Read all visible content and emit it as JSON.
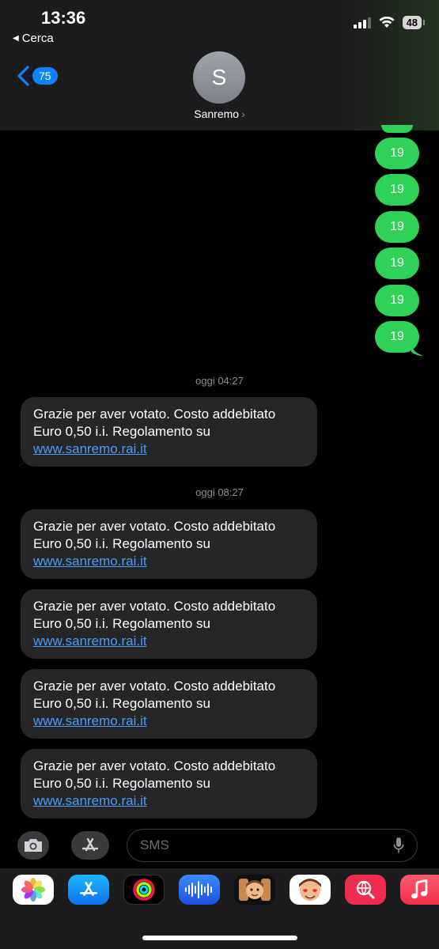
{
  "status_bar": {
    "time": "13:36",
    "back_app": "Cerca",
    "battery": "48"
  },
  "nav": {
    "unread_badge": "75",
    "avatar_initial": "S",
    "contact_name": "Sanremo"
  },
  "sent_messages": [
    "19",
    "19",
    "19",
    "19",
    "19",
    "19"
  ],
  "timestamps": [
    "oggi 04:27",
    "oggi 08:27"
  ],
  "received_message": {
    "line1": "Grazie per aver votato. Costo addebitato",
    "line2": "Euro 0,50 i.i. Regolamento su",
    "link": "www.sanremo.rai.it"
  },
  "input": {
    "placeholder": "SMS"
  },
  "app_drawer": [
    "photos-app",
    "app-store-app",
    "activity-app",
    "voice-memos-app",
    "memoji-app",
    "memoji-stickers-app",
    "search-web-app",
    "music-app"
  ],
  "colors": {
    "sent_bubble": "#30d158",
    "received_bubble": "#262628",
    "accent": "#0a84ff",
    "link": "#4a9cf5"
  }
}
